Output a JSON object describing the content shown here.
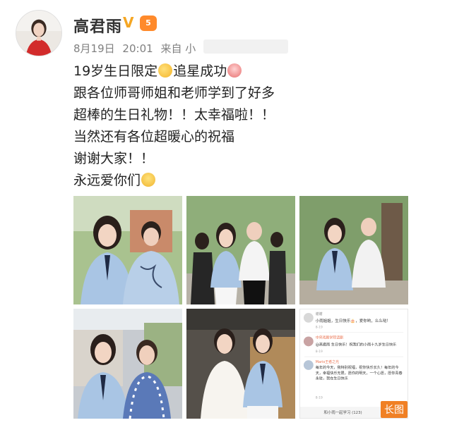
{
  "user": {
    "name": "高君雨",
    "verified": "V",
    "level": "5"
  },
  "meta": {
    "date": "8月19日",
    "time": "20:01",
    "source": "来自 小"
  },
  "post": {
    "line1_a": "19岁生日限定",
    "line1_b": "追星成功",
    "line2": "跟各位师哥师姐和老师学到了好多",
    "line3": "超棒的生日礼物！！太幸福啦！！",
    "line4": "当然还有各位超暖心的祝福",
    "line5": "谢谢大家！！",
    "line6": "永远爱你们"
  },
  "screenshot": {
    "comments": [
      {
        "user": "谢谢",
        "text": "小雨姐姐，生日快乐🎂，爱你哟，么么哒！",
        "time": "8-19"
      },
      {
        "user": "中央戏剧学院话剧",
        "text": "@高君雨 生日快乐！祝我们的小雨十九岁生日快乐",
        "time": "8-19"
      },
      {
        "user": "Mario王者之光",
        "text": "每年的今天，我特别祝福，祝你快乐长久！每年的今天，幸福快乐无限，愿你的明天，一个心愿，愿你青春永驻，我在生日快乐",
        "time": "8-19"
      }
    ],
    "footer": "和小雨一起学习 (123)",
    "long_badge": "长图"
  },
  "colors": {
    "name": "#333333",
    "meta": "#808080",
    "badge": "#f08024",
    "verified": "#f5a623"
  }
}
